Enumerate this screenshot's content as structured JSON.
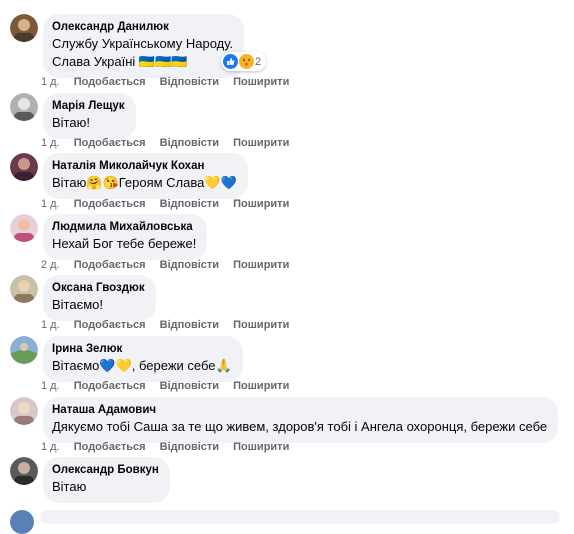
{
  "comments": [
    {
      "author": "Олександр Данилюк",
      "lines": [
        "Службу Українському Народу.",
        "Слава Україні 🇺🇦🇺🇦🇺🇦"
      ],
      "time": "1 д.",
      "reaction_count": "2",
      "avatar_color": "#7a5a3a"
    },
    {
      "author": "Марія Лещук",
      "lines": [
        "Вітаю!"
      ],
      "time": "1 д.",
      "avatar_color": "#8a8a8a"
    },
    {
      "author": "Наталія Миколайчук Кохан",
      "lines": [
        "Вітаю🤗😘Героям Слава💛💙"
      ],
      "time": "1 д.",
      "avatar_color": "#6b3a4a"
    },
    {
      "author": "Людмила Михайловська",
      "lines": [
        "Нехай Бог тебе береже!"
      ],
      "time": "2 д.",
      "avatar_color": "#c0507a"
    },
    {
      "author": "Оксана Гвоздюк",
      "lines": [
        "Вітаємо!"
      ],
      "time": "1 д.",
      "avatar_color": "#9a8a6a"
    },
    {
      "author": "Ірина Зелюк",
      "lines": [
        "Вітаємо💙💛, бережи себе🙏"
      ],
      "time": "1 д.",
      "avatar_color": "#6a9a5a"
    },
    {
      "author": "Наташа Адамович",
      "lines": [
        "Дякуємо тобі Саша за те що живем, здоров'я тобі і Ангела охоронця, бережи себе"
      ],
      "time": "1 д.",
      "avatar_color": "#9a7a7a"
    },
    {
      "author": "Олександр Бовкун",
      "lines": [
        "Вітаю"
      ],
      "time": "1 д.",
      "avatar_color": "#3a3a3a"
    }
  ],
  "actions": {
    "like": "Подобається",
    "reply": "Відповісти",
    "share": "Поширити"
  },
  "colors": {
    "bubble": "#f0f2f5",
    "meta": "#65676b",
    "like_blue": "#1877f2"
  },
  "icons": {
    "like": "thumbs-up-icon",
    "care": "care-hug-icon"
  }
}
